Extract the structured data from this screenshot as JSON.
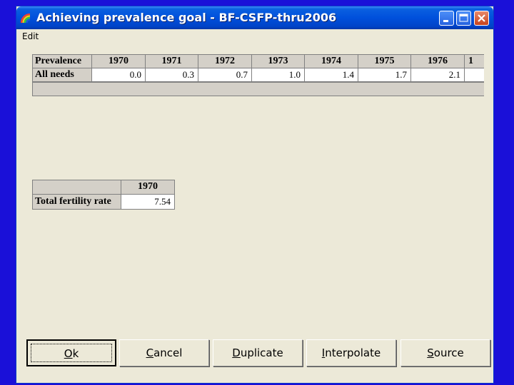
{
  "window": {
    "title": "Achieving prevalence goal - BF-CSFP-thru2006",
    "app_icon": "rainbow-app-icon",
    "controls": [
      "minimize-icon",
      "maximize-icon",
      "close-icon"
    ]
  },
  "menu": {
    "items": [
      "Edit"
    ]
  },
  "prevalence_table": {
    "corner_label": "Prevalence",
    "row_label": "All needs",
    "years": [
      "1970",
      "1971",
      "1972",
      "1973",
      "1974",
      "1975",
      "1976",
      "1"
    ],
    "values": [
      "0.0",
      "0.3",
      "0.7",
      "1.0",
      "1.4",
      "1.7",
      "2.1",
      ""
    ]
  },
  "tfr_table": {
    "year": "1970",
    "row_label": "Total fertility rate",
    "value": "7.54"
  },
  "buttons": [
    {
      "pre": "",
      "key": "O",
      "post": "k"
    },
    {
      "pre": "",
      "key": "C",
      "post": "ancel"
    },
    {
      "pre": "",
      "key": "D",
      "post": "uplicate"
    },
    {
      "pre": "",
      "key": "I",
      "post": "nterpolate"
    },
    {
      "pre": "",
      "key": "S",
      "post": "ource"
    }
  ],
  "colors": {
    "background": "#1a10d8",
    "dialog": "#ece9d8",
    "titlebar": "#0050dc"
  }
}
